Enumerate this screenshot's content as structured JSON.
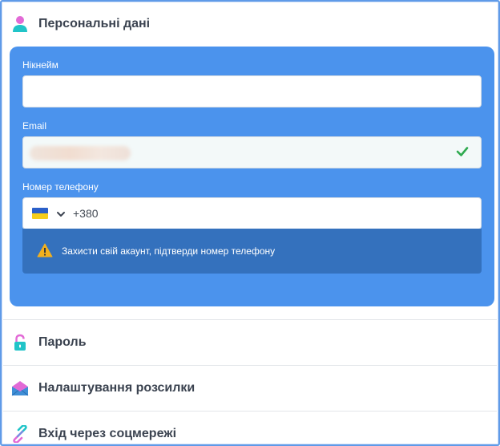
{
  "sections": {
    "personal": {
      "title": "Персональні дані",
      "icon": "user-icon"
    },
    "password": {
      "title": "Пароль",
      "icon": "lock-icon"
    },
    "mailing": {
      "title": "Налаштування розсилки",
      "icon": "envelope-icon"
    },
    "social": {
      "title": "Вхід через соцмережі",
      "icon": "link-icon"
    }
  },
  "form": {
    "nickname": {
      "label": "Нікнейм",
      "value": ""
    },
    "email": {
      "label": "Email",
      "status": "verified",
      "status_icon": "checkmark-icon"
    },
    "phone": {
      "label": "Номер телефону",
      "country_flag": "ukraine-flag-icon",
      "dial_code": "+380",
      "notice": "Захисти свій акаунт, підтверди номер телефону",
      "notice_icon": "warning-icon"
    }
  },
  "colors": {
    "panel": "#4b93ed",
    "notice": "#3471bd",
    "frame": "#5f9ae8",
    "check": "#2eaa4f",
    "warning": "#f2b01e"
  }
}
